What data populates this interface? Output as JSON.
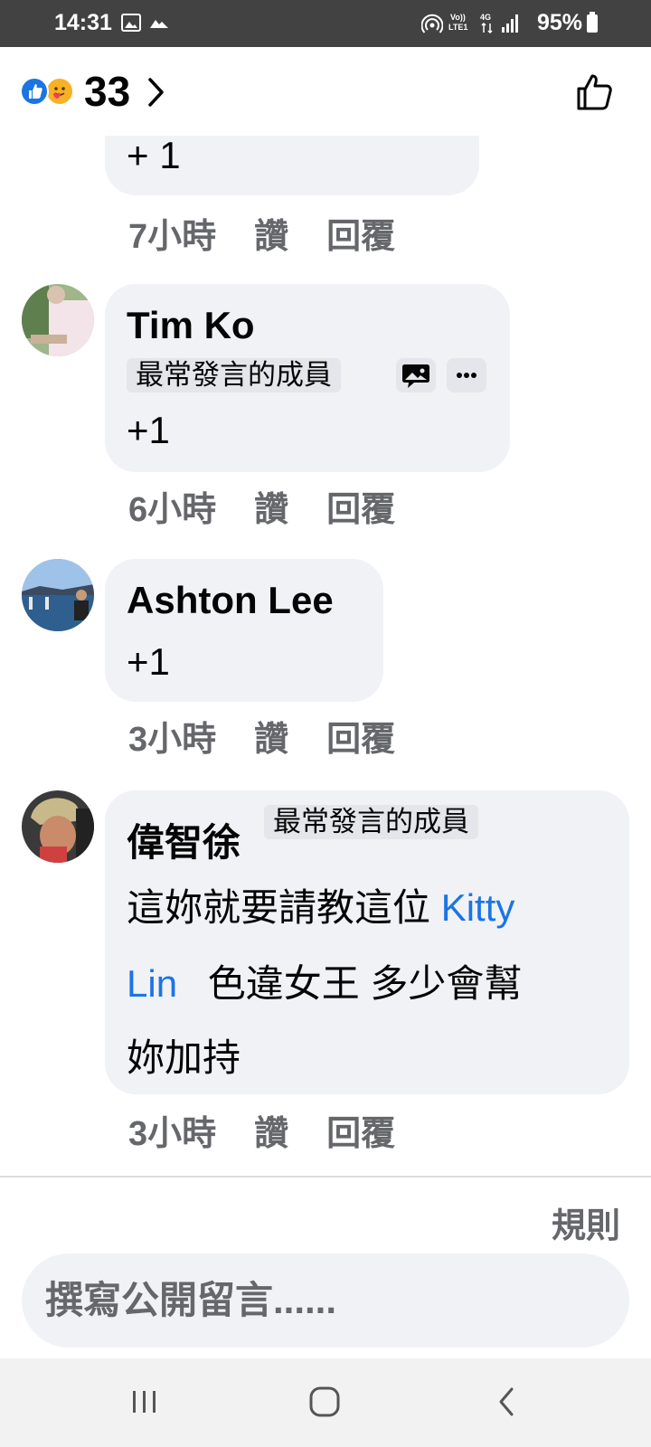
{
  "status_bar": {
    "time": "14:31",
    "network_label_top": "Vo))",
    "network_label_bottom": "LTE1",
    "network_type": "4G",
    "battery": "95%",
    "icons": [
      "gallery-icon",
      "cloud-icon",
      "hotspot-icon",
      "signal-icon",
      "battery-icon"
    ]
  },
  "header": {
    "reactions": [
      "like-reaction-icon",
      "care-reaction-icon"
    ],
    "reaction_count": "33"
  },
  "comments": [
    {
      "id": "prev",
      "text": "+ 1",
      "time": "7小時",
      "like_label": "讚",
      "reply_label": "回覆"
    },
    {
      "id": "tim",
      "author": "Tim Ko",
      "badge": "最常發言的成員",
      "text": "+1",
      "time": "6小時",
      "like_label": "讚",
      "reply_label": "回覆"
    },
    {
      "id": "ashton",
      "author": "Ashton Lee",
      "text": "+1",
      "time": "3小時",
      "like_label": "讚",
      "reply_label": "回覆"
    },
    {
      "id": "wei",
      "author": "偉智徐",
      "badge": "最常發言的成員",
      "text_line1": "這妳就要請教這位",
      "mention": "Kitty Lin",
      "mention_part1": "Kitty",
      "mention_part2": "Lin",
      "text_line2_rest": "色違女王 多少會幫",
      "text_line3": "妳加持",
      "time": "3小時",
      "like_label": "讚",
      "reply_label": "回覆"
    }
  ],
  "footer": {
    "rules_label": "規則",
    "input_placeholder": "撰寫公開留言......"
  },
  "colors": {
    "status_bar": "#424242",
    "bubble": "#f0f2f5",
    "badge": "#e4e6eb",
    "meta_text": "#65676b",
    "mention": "#1b74e4",
    "like_blue": "#1b74e4",
    "nav_bar": "#f2f2f2"
  }
}
